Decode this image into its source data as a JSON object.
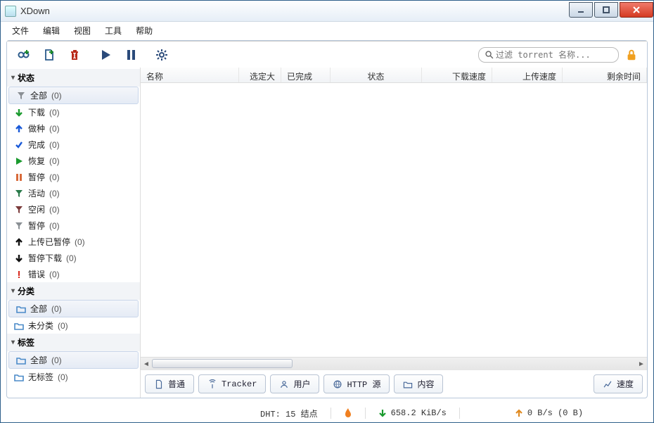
{
  "window": {
    "title": "XDown"
  },
  "menu": {
    "file": "文件",
    "edit": "编辑",
    "view": "视图",
    "tools": "工具",
    "help": "帮助"
  },
  "search": {
    "placeholder": "过滤 torrent 名称..."
  },
  "sidebar": {
    "groups": [
      {
        "title": "状态",
        "items": [
          {
            "icon": "funnel",
            "color": "#8a8f94",
            "label": "全部",
            "count": 0,
            "selected": true
          },
          {
            "icon": "arrow-down",
            "color": "#1a9a2e",
            "label": "下载",
            "count": 0
          },
          {
            "icon": "arrow-up",
            "color": "#1a5ad8",
            "label": "做种",
            "count": 0
          },
          {
            "icon": "check",
            "color": "#1a5ad8",
            "label": "完成",
            "count": 0
          },
          {
            "icon": "play",
            "color": "#1a9a2e",
            "label": "恢复",
            "count": 0
          },
          {
            "icon": "pause",
            "color": "#d86a3a",
            "label": "暂停",
            "count": 0
          },
          {
            "icon": "funnel",
            "color": "#2a7a4a",
            "label": "活动",
            "count": 0
          },
          {
            "icon": "funnel",
            "color": "#7a3a3a",
            "label": "空闲",
            "count": 0
          },
          {
            "icon": "funnel",
            "color": "#8a8f94",
            "label": "暂停",
            "count": 0
          },
          {
            "icon": "arrow-up",
            "color": "#111",
            "label": "上传已暂停",
            "count": 0
          },
          {
            "icon": "arrow-down",
            "color": "#111",
            "label": "暂停下载",
            "count": 0
          },
          {
            "icon": "exclaim",
            "color": "#d8261a",
            "label": "错误",
            "count": 0
          }
        ]
      },
      {
        "title": "分类",
        "items": [
          {
            "icon": "folder",
            "color": "#4a8ac8",
            "label": "全部",
            "count": 0,
            "selected": true
          },
          {
            "icon": "folder",
            "color": "#4a8ac8",
            "label": "未分类",
            "count": 0
          }
        ]
      },
      {
        "title": "标签",
        "items": [
          {
            "icon": "folder",
            "color": "#4a8ac8",
            "label": "全部",
            "count": 0,
            "selected": true
          },
          {
            "icon": "folder",
            "color": "#4a8ac8",
            "label": "无标签",
            "count": 0
          }
        ]
      }
    ]
  },
  "columns": {
    "name": "名称",
    "size": "选定大小",
    "done": "已完成",
    "status": "状态",
    "dl": "下载速度",
    "ul": "上传速度",
    "eta": "剩余时间"
  },
  "tabs": {
    "general": "普通",
    "tracker": "Tracker",
    "peers": "用户",
    "http": "HTTP 源",
    "content": "内容",
    "speed": "速度"
  },
  "status": {
    "dht": "DHT: 15 结点",
    "dl_speed": "658.2 KiB/s",
    "ul_speed": "0 B/s (0 B)"
  }
}
